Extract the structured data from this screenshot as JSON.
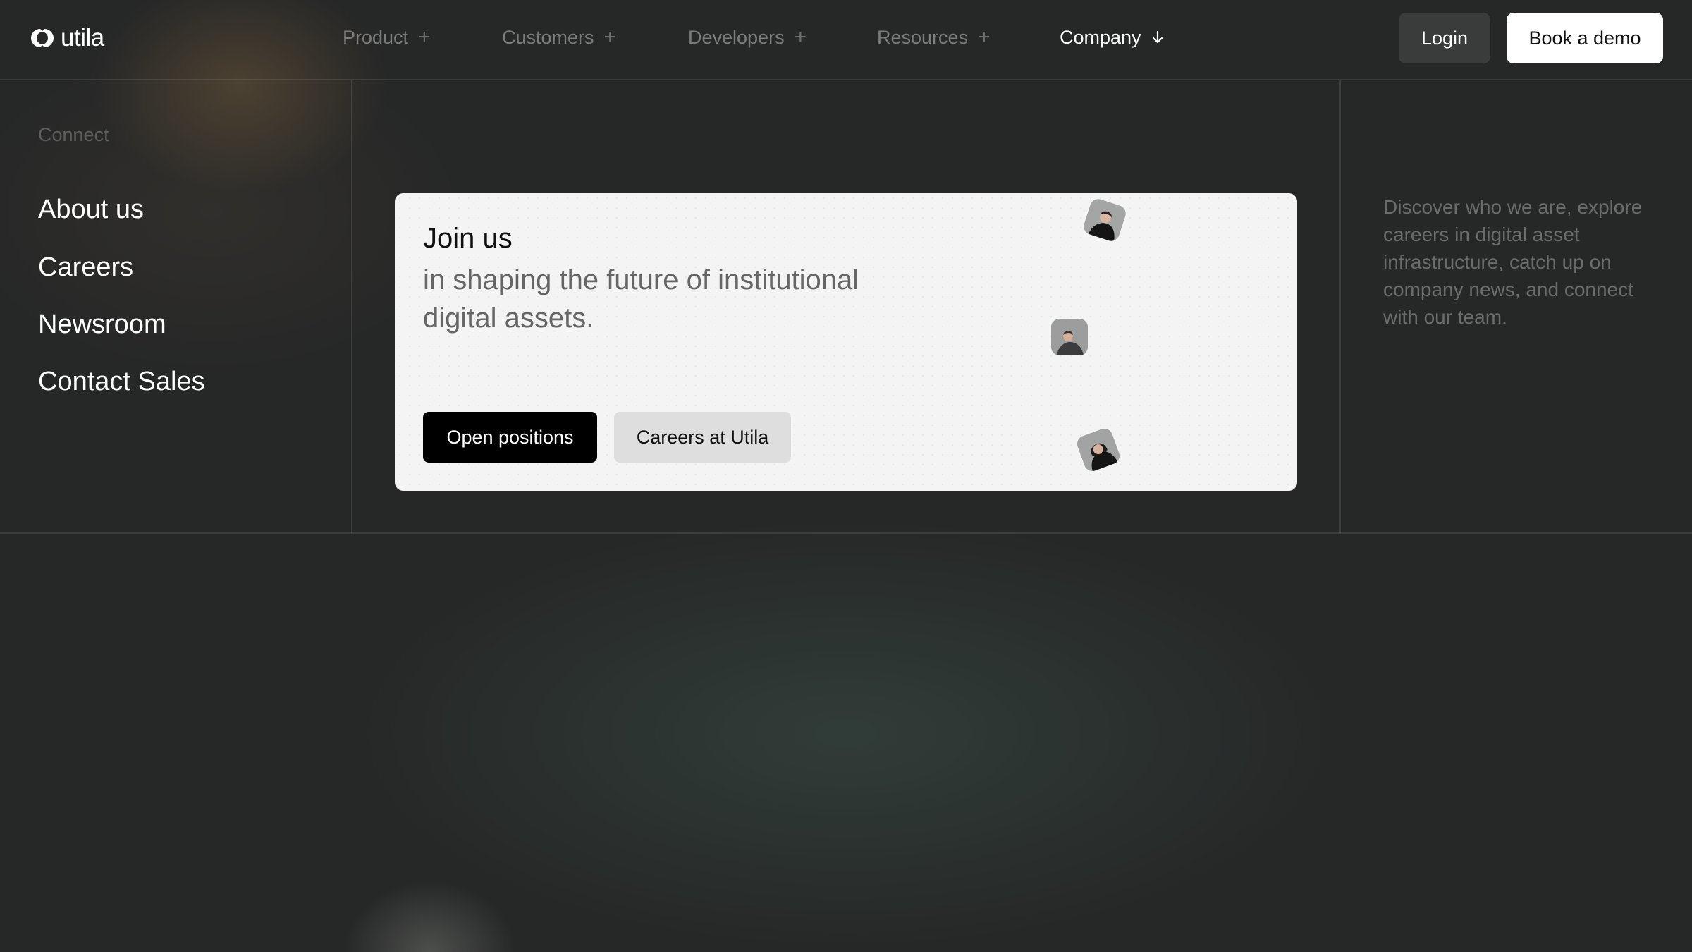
{
  "brand": {
    "name": "utila"
  },
  "nav": {
    "items": [
      {
        "label": "Product",
        "icon": "plus-icon"
      },
      {
        "label": "Customers",
        "icon": "plus-icon"
      },
      {
        "label": "Developers",
        "icon": "plus-icon"
      },
      {
        "label": "Resources",
        "icon": "plus-icon"
      },
      {
        "label": "Company",
        "icon": "arrow-down-icon",
        "active": true
      }
    ],
    "plus_glyph": "+"
  },
  "header": {
    "login_label": "Login",
    "demo_label": "Book a demo"
  },
  "menu": {
    "section_label": "Connect",
    "links": [
      "About us",
      "Careers",
      "Newsroom",
      "Contact Sales"
    ]
  },
  "card": {
    "title": "Join us",
    "subtitle": "in shaping the future of institutional digital assets.",
    "primary_button": "Open positions",
    "secondary_button": "Careers at Utila"
  },
  "description": "Discover who we are, explore careers in digital asset infrastructure, catch up on company news, and connect with our team.",
  "colors": {
    "background": "#262727",
    "card": "#f4f4f4",
    "primary_button": "#000000",
    "secondary_button": "#dedede",
    "demo_button": "#ffffff",
    "login_button": "#3a3b3b",
    "nav_inactive": "#7b7c7b"
  }
}
